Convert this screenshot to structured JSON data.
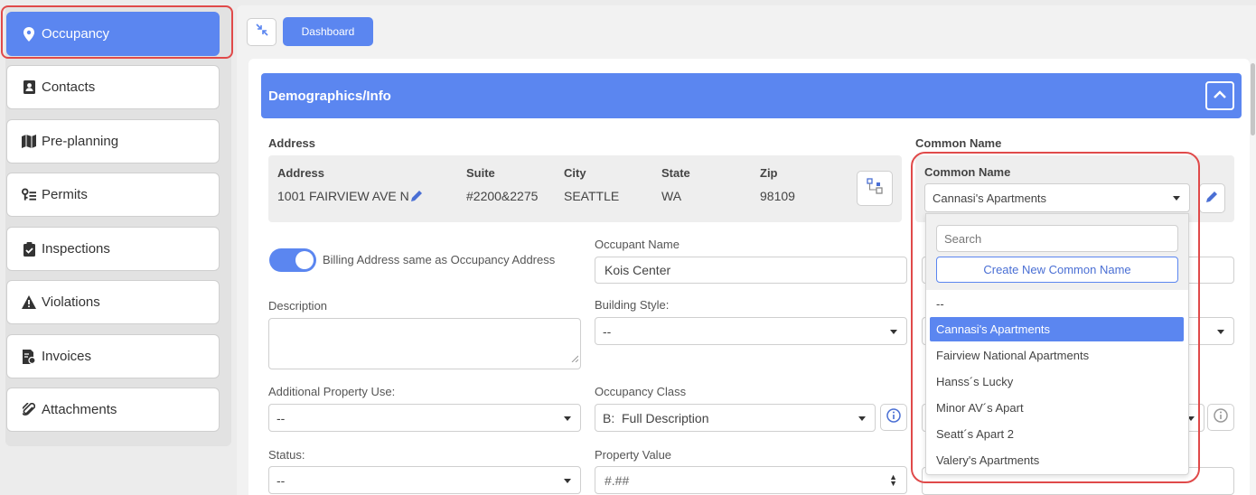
{
  "sidebar": {
    "items": [
      {
        "label": "Occupancy",
        "icon": "map-pin-icon",
        "active": true
      },
      {
        "label": "Contacts",
        "icon": "contact-card-icon"
      },
      {
        "label": "Pre-planning",
        "icon": "map-icon"
      },
      {
        "label": "Permits",
        "icon": "key-list-icon"
      },
      {
        "label": "Inspections",
        "icon": "clipboard-check-icon"
      },
      {
        "label": "Violations",
        "icon": "warning-triangle-icon"
      },
      {
        "label": "Invoices",
        "icon": "invoice-icon"
      },
      {
        "label": "Attachments",
        "icon": "paperclip-icon"
      }
    ]
  },
  "toolbar": {
    "dashboard_label": "Dashboard"
  },
  "section": {
    "title": "Demographics/Info"
  },
  "address": {
    "section_label": "Address",
    "headers": {
      "address": "Address",
      "suite": "Suite",
      "city": "City",
      "state": "State",
      "zip": "Zip"
    },
    "values": {
      "address": "1001 FAIRVIEW AVE N",
      "suite": "#2200&2275",
      "city": "SEATTLE",
      "state": "WA",
      "zip": "98109"
    }
  },
  "common_name": {
    "section_label": "Common Name",
    "field_label": "Common Name",
    "selected": "Cannasi's Apartments",
    "search_placeholder": "Search",
    "create_label": "Create New Common Name",
    "options": [
      "--",
      "Cannasi's Apartments",
      "Fairview National Apartments",
      "Hanss´s Lucky",
      "Minor AV´s Apart",
      "Seatt´s Apart 2",
      "Valery's Apartments"
    ],
    "selected_index": 1
  },
  "form": {
    "billing_toggle_label": "Billing Address same as Occupancy Address",
    "billing_toggle_on": true,
    "occupant_name_label": "Occupant Name",
    "occupant_name_value": "Kois Center",
    "description_label": "Description",
    "building_style_label": "Building Style:",
    "building_style_value": "--",
    "additional_use_label": "Additional Property Use:",
    "additional_use_value": "--",
    "occupancy_class_label": "Occupancy Class",
    "occupancy_class_value": "B:  Full Description",
    "status_label": "Status:",
    "status_value": "--",
    "property_value_label": "Property Value",
    "property_value_placeholder": "#.##"
  },
  "colors": {
    "accent": "#5b86f0",
    "highlight_outline": "#e04a4a"
  }
}
